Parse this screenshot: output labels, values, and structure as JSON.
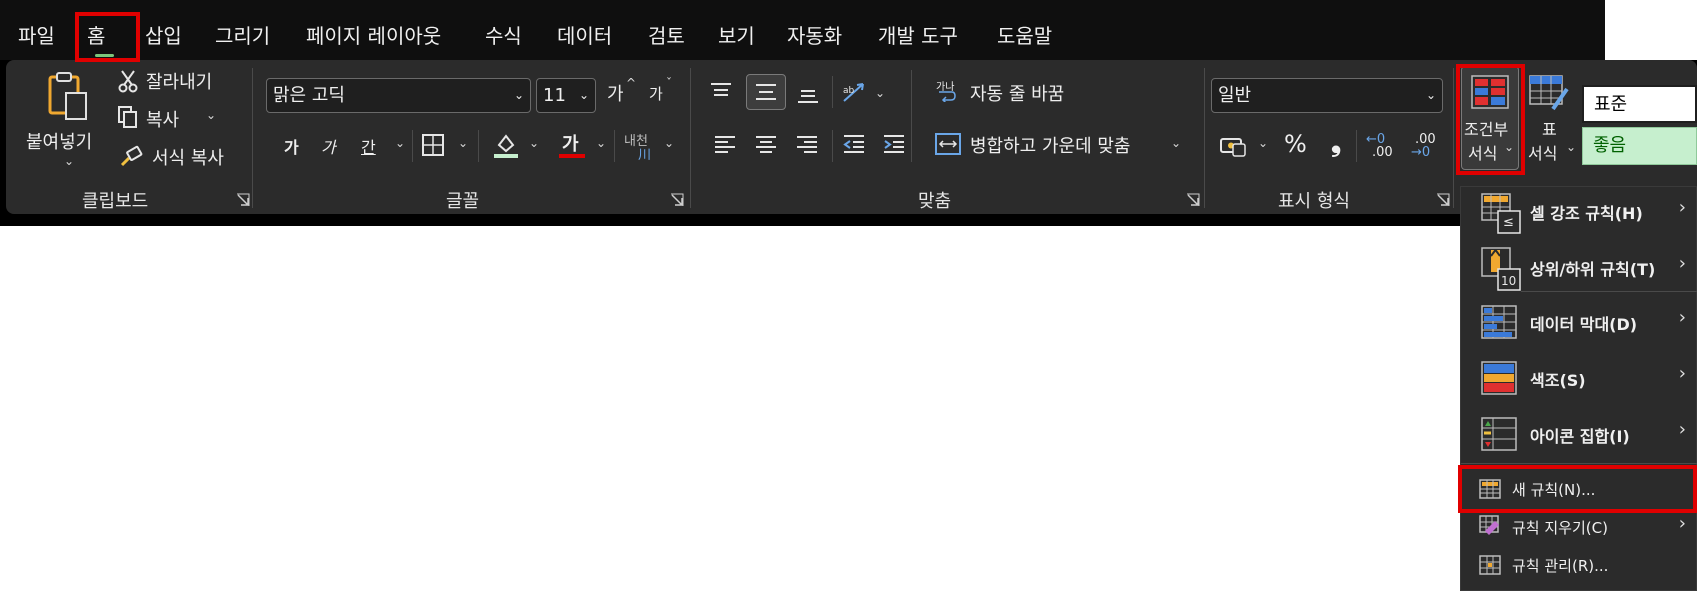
{
  "menu_tabs": [
    "파일",
    "홈",
    "삽입",
    "그리기",
    "페이지 레이아웃",
    "수식",
    "데이터",
    "검토",
    "보기",
    "자동화",
    "개발 도구",
    "도움말"
  ],
  "clipboard": {
    "paste_label": "붙여넣기",
    "cut_label": "잘라내기",
    "copy_label": "복사",
    "format_painter_label": "서식 복사",
    "group_label": "클립보드"
  },
  "font": {
    "font_name": "맑은 고딕",
    "font_size": "11",
    "grow_label": "가",
    "shrink_label": "가",
    "bold_label": "가",
    "italic_label": "가",
    "underline_label": "간",
    "font_color_label": "가",
    "phonetic_label": "내천",
    "phonetic_sub": "川",
    "group_label": "글꼴"
  },
  "alignment": {
    "wrap_text_label": "자동 줄 바꿈",
    "wrap_icon_text": "가나",
    "merge_center_label": "병합하고 가운데 맞춤",
    "group_label": "맞춤"
  },
  "number": {
    "format_value": "일반",
    "percent_symbol": "%",
    "comma_symbol": "❟",
    "increase_decimal_top": "←0",
    "increase_decimal_bottom": ".00",
    "decrease_decimal_top": ".00",
    "decrease_decimal_bottom": "→0",
    "group_label": "표시 형식"
  },
  "styles": {
    "conditional_format_line1": "조건부",
    "conditional_format_line2": "서식",
    "format_table_line1": "표",
    "format_table_line2": "서식",
    "style_normal": "표준",
    "style_good": "좋음"
  },
  "cf_menu": {
    "items": [
      {
        "label": "셀 강조 규칙(H)",
        "icon": "highlight-cells-icon",
        "submenu": true
      },
      {
        "label": "상위/하위 규칙(T)",
        "icon": "top-bottom-icon",
        "submenu": true
      },
      {
        "label": "데이터 막대(D)",
        "icon": "data-bars-icon",
        "submenu": true
      },
      {
        "label": "색조(S)",
        "icon": "color-scales-icon",
        "submenu": true
      },
      {
        "label": "아이콘 집합(I)",
        "icon": "icon-sets-icon",
        "submenu": true
      }
    ],
    "new_rule": "새 규칙(N)...",
    "clear_rules": "규칙 지우기(C)",
    "manage_rules": "규칙 관리(R)...",
    "icon_badge_less": "≤",
    "icon_badge_ten": "10"
  },
  "colors": {
    "highlight_red": "#e00000",
    "ribbon_bg": "#2b2b2b",
    "topbar_bg": "#0f0f0f",
    "good_style_bg": "#c6efce",
    "good_style_text": "#006100"
  }
}
